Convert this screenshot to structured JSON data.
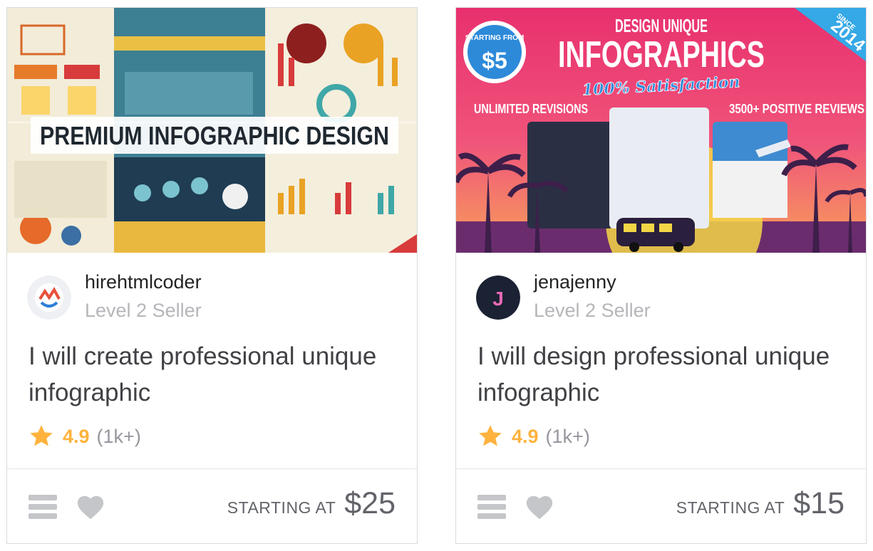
{
  "gigs": [
    {
      "thumbnail_banner": "PREMIUM INFOGRAPHIC DESIGN",
      "seller_name": "hirehtmlcoder",
      "seller_level": "Level 2 Seller",
      "title": "I will create professional unique infographic",
      "rating": "4.9",
      "rating_count": "(1k+)",
      "price_label": "STARTING AT",
      "price": "$25"
    },
    {
      "thumbnail_heading": "DESIGN UNIQUE",
      "thumbnail_title": "INFOGRAPHICS",
      "thumbnail_tagline": "100% Satisfaction",
      "thumbnail_left": "UNLIMITED REVISIONS",
      "thumbnail_right": "3500+ POSITIVE REVIEWS",
      "thumbnail_badge_top": "STARTING FROM",
      "thumbnail_badge_price": "$5",
      "thumbnail_since": "SINCE",
      "thumbnail_year": "2014",
      "seller_name": "jenajenny",
      "seller_level": "Level 2 Seller",
      "avatar_letter": "J",
      "title": "I will design professional unique infographic",
      "rating": "4.9",
      "rating_count": "(1k+)",
      "price_label": "STARTING AT",
      "price": "$15"
    }
  ],
  "colors": {
    "star": "#ffb33e",
    "icon_gray": "#c5c6c9",
    "text_muted": "#b5b6ba"
  }
}
